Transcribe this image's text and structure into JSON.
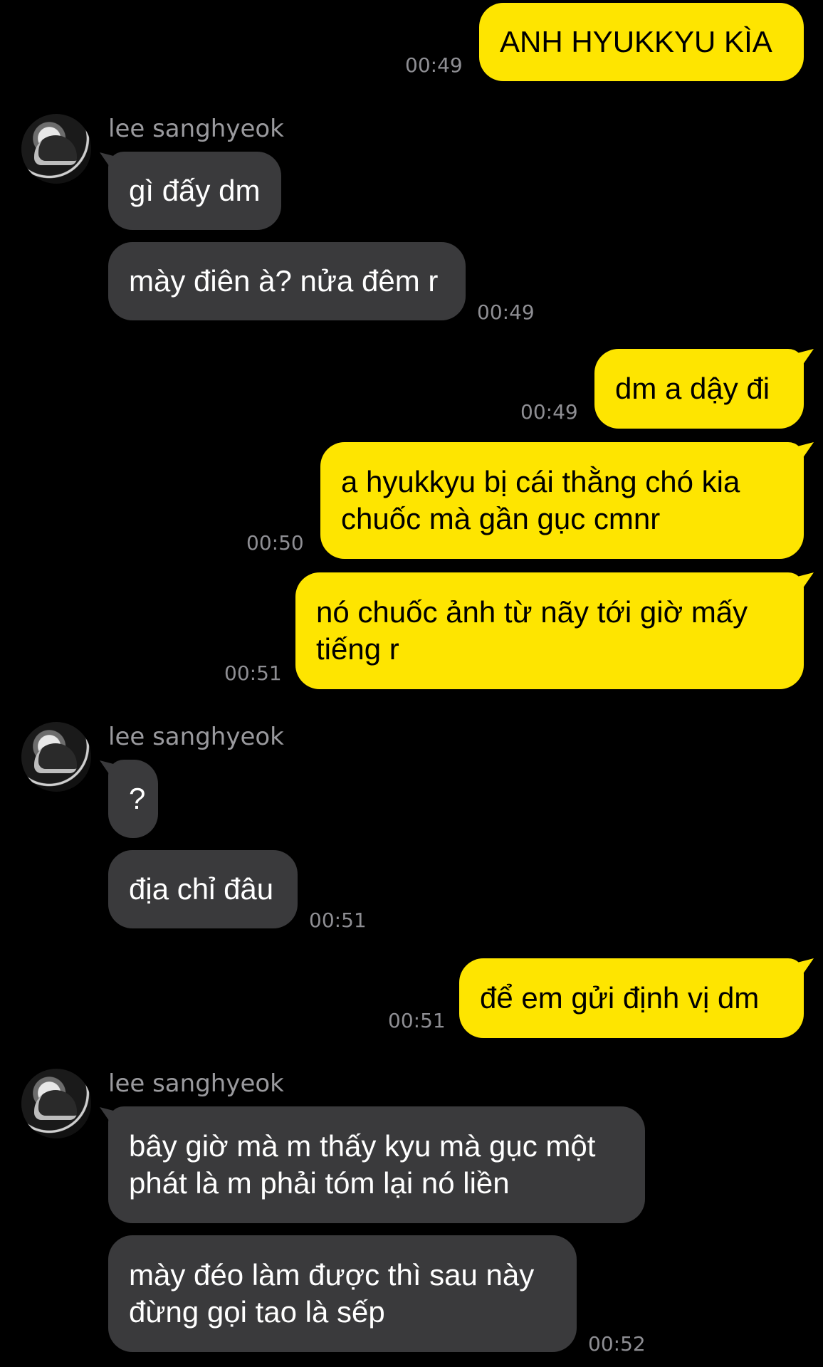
{
  "contact": {
    "name": "lee sanghyeok"
  },
  "colors": {
    "background": "#000000",
    "outgoing_bubble": "#FEE500",
    "incoming_bubble": "#3A3A3C",
    "timestamp": "#8E8E93",
    "sender_name": "#9A9A9E"
  },
  "messages": [
    {
      "direction": "outgoing",
      "text": "ANH HYUKKYU KÌA",
      "time": "00:49"
    },
    {
      "direction": "incoming",
      "text": "gì đấy dm"
    },
    {
      "direction": "incoming",
      "text": "mày điên à? nửa đêm r",
      "time": "00:49"
    },
    {
      "direction": "outgoing",
      "text": "dm a dậy đi",
      "time": "00:49"
    },
    {
      "direction": "outgoing",
      "lines": [
        "a hyukkyu bị cái thằng chó kia",
        "chuốc mà gần gục cmnr"
      ],
      "time": "00:50"
    },
    {
      "direction": "outgoing",
      "lines": [
        "nó chuốc ảnh từ nãy tới giờ mấy",
        "tiếng r"
      ],
      "time": "00:51"
    },
    {
      "direction": "incoming",
      "text": "?"
    },
    {
      "direction": "incoming",
      "text": "địa chỉ đâu",
      "time": "00:51"
    },
    {
      "direction": "outgoing",
      "text": "để em gửi định vị dm",
      "time": "00:51"
    },
    {
      "direction": "incoming",
      "lines": [
        "bây giờ mà m thấy kyu mà gục một",
        "phát là m phải tóm lại nó liền"
      ]
    },
    {
      "direction": "incoming",
      "lines": [
        "mày đéo làm được thì sau này",
        "đừng gọi tao là sếp"
      ],
      "time": "00:52"
    }
  ]
}
